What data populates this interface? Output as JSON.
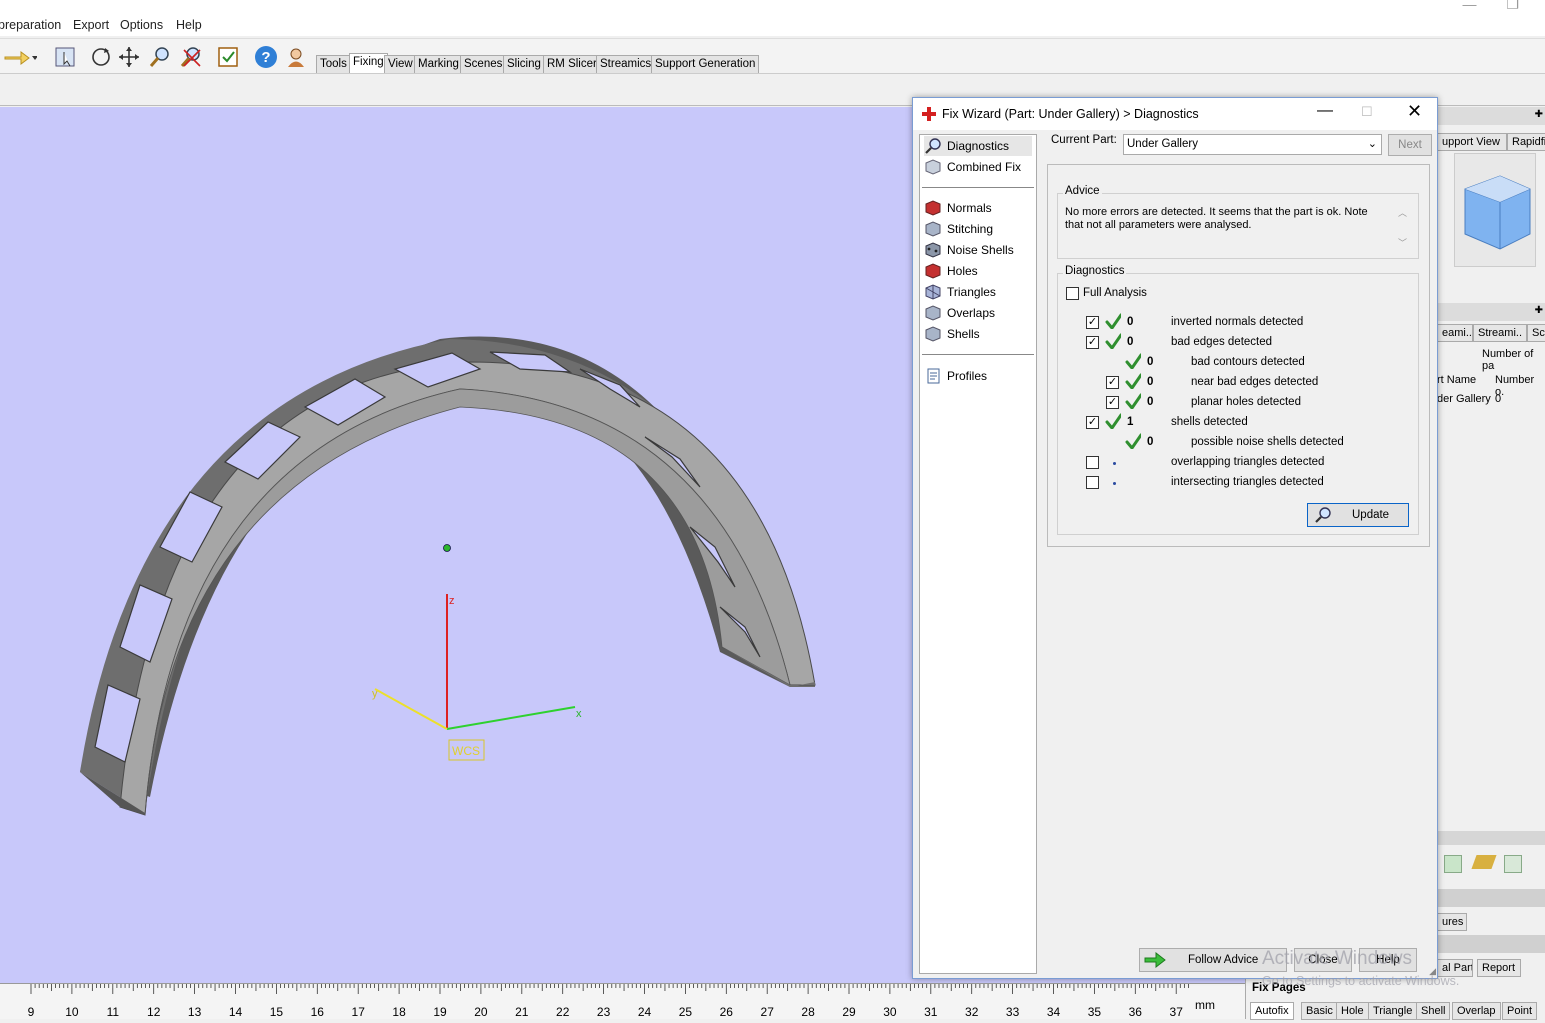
{
  "menubar": {
    "items": [
      "preparation",
      "Export",
      "Options",
      "Help"
    ]
  },
  "toolbar": {
    "tabs": [
      "Tools",
      "Fixing",
      "View",
      "Marking",
      "Scenes",
      "Slicing",
      "RM Slicer",
      "Streamics",
      "Support Generation"
    ],
    "active_tab": "Fixing"
  },
  "viewport": {
    "background": "#c8c8fa",
    "axes": {
      "z": "z",
      "x": "x",
      "y": "y",
      "label": "WCS"
    }
  },
  "ruler": {
    "ticks": [
      "9",
      "10",
      "11",
      "12",
      "13",
      "14",
      "15",
      "16",
      "17",
      "18",
      "19",
      "20",
      "21",
      "22",
      "23",
      "24",
      "25",
      "26",
      "27",
      "28",
      "29",
      "30",
      "31",
      "32",
      "33",
      "34",
      "35",
      "36",
      "37"
    ],
    "unit": "mm"
  },
  "dialog": {
    "title": "Fix Wizard (Part: Under Gallery) > Diagnostics",
    "nav": {
      "top": [
        "Diagnostics",
        "Combined Fix"
      ],
      "middle": [
        "Normals",
        "Stitching",
        "Noise Shells",
        "Holes",
        "Triangles",
        "Overlaps",
        "Shells"
      ],
      "bottom": [
        "Profiles"
      ]
    },
    "current_part_label": "Current Part:",
    "current_part_value": "Under Gallery",
    "next_button": "Next",
    "advice": {
      "title": "Advice",
      "text": "No more errors are detected. It seems that the part is ok. Note that not all parameters were analysed."
    },
    "diagnostics": {
      "title": "Diagnostics",
      "full_analysis": "Full Analysis",
      "rows": [
        {
          "checkbox": true,
          "ok": true,
          "count": "0",
          "label": "inverted normals detected",
          "indent": 0
        },
        {
          "checkbox": true,
          "ok": true,
          "count": "0",
          "label": "bad edges detected",
          "indent": 0
        },
        {
          "checkbox": null,
          "ok": true,
          "count": "0",
          "label": "bad contours detected",
          "indent": 1
        },
        {
          "checkbox": true,
          "ok": true,
          "count": "0",
          "label": "near bad edges detected",
          "indent": 1
        },
        {
          "checkbox": true,
          "ok": true,
          "count": "0",
          "label": "planar holes detected",
          "indent": 1
        },
        {
          "checkbox": true,
          "ok": true,
          "count": "1",
          "label": "shells detected",
          "indent": 0
        },
        {
          "checkbox": null,
          "ok": true,
          "count": "0",
          "label": "possible noise shells detected",
          "indent": 1
        },
        {
          "checkbox": false,
          "ok": false,
          "count": "",
          "label": "overlapping triangles detected",
          "indent": 0
        },
        {
          "checkbox": false,
          "ok": false,
          "count": "",
          "label": "intersecting triangles detected",
          "indent": 0
        }
      ],
      "update_button": "Update"
    },
    "footer": {
      "follow_advice": "Follow Advice",
      "close": "Close",
      "help": "Help"
    }
  },
  "rightpanel": {
    "tabs_top": [
      "upport View",
      "Rapidfit"
    ],
    "tabs_mid": [
      "eami..",
      "Streami..",
      "Sc"
    ],
    "number_of_parts": "Number of pa",
    "columns": [
      "rt Name",
      "Number o."
    ],
    "row": [
      "der Gallery",
      "0"
    ],
    "tab_ures": "ures",
    "bottom_tabs": [
      "al Part",
      "Report"
    ]
  },
  "fixpages": {
    "title": "Fix Pages",
    "tabs": [
      "Autofix",
      "Basic",
      "Hole",
      "Triangle",
      "Shell",
      "Overlap",
      "Point"
    ]
  },
  "watermark": {
    "line1": "Activate Windows",
    "line2": "Go to Settings to activate Windows."
  }
}
